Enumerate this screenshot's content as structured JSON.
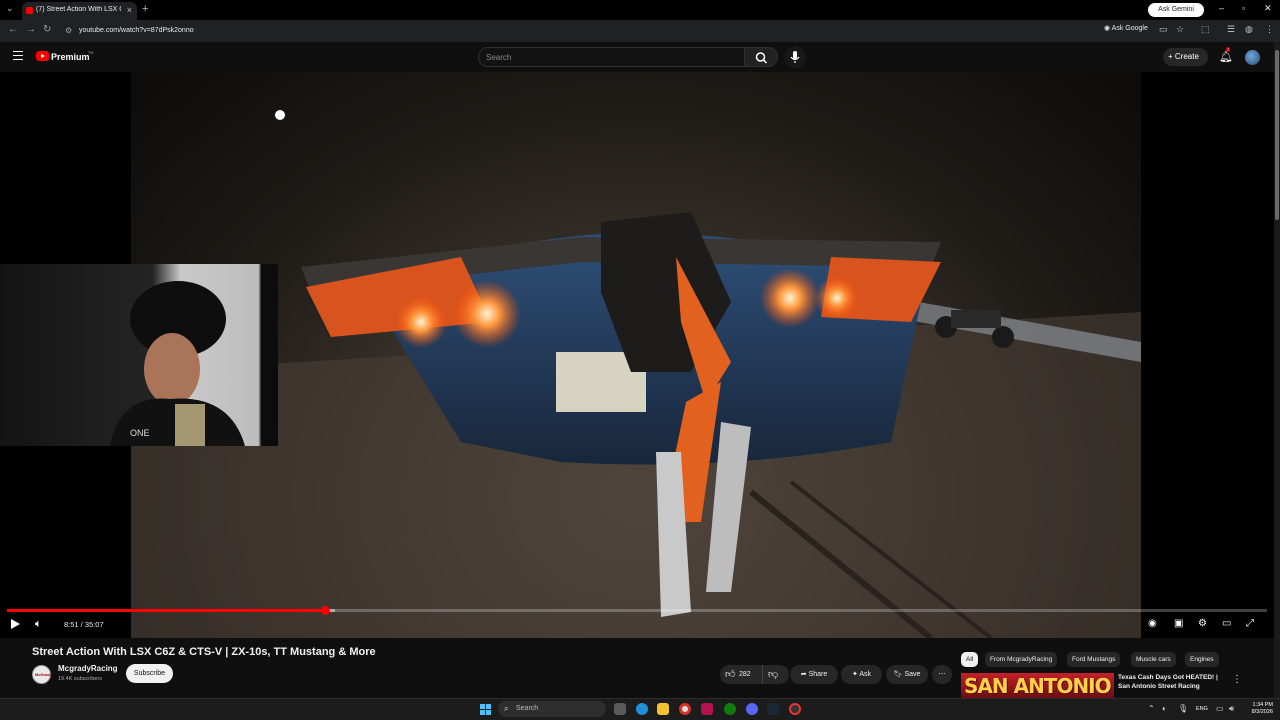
{
  "browser": {
    "tab_title": "(7) Street Action With LSX C6Z",
    "url": "youtube.com/watch?v=87dPsk2onno",
    "ask_gemini": "Ask Gemini",
    "ask_google": "Ask Google"
  },
  "header": {
    "brand": "Premium",
    "region": "TH",
    "search_placeholder": "Search",
    "create_label": "Create",
    "notifications": "7"
  },
  "player": {
    "current_time": "8:51",
    "duration": "35:07",
    "time_display": "8:51 / 35:07",
    "progress_fraction": 0.252,
    "buffer_fraction": 0.26
  },
  "video": {
    "title": "Street Action With LSX C6Z & CTS-V | ZX-10s, TT Mustang & More",
    "channel_name": "McgradyRacing",
    "channel_avatar_text": "McGrady",
    "subscribers": "19.4K subscribers",
    "subscribe_label": "Subscribe",
    "likes": "282",
    "share_label": "Share",
    "ask_label": "Ask",
    "save_label": "Save"
  },
  "chips": [
    "All",
    "From McgradyRacing",
    "Ford Mustangs",
    "Muscle cars",
    "Engines"
  ],
  "recommended": {
    "thumb_text": "SAN ANTONIO",
    "title": "Texas Cash Days Got HEATED! | San Antonio Street Racing"
  },
  "taskbar": {
    "search_label": "Search",
    "language": "ENG",
    "time": "1:34 PM",
    "date": "8/3/2026"
  },
  "colors": {
    "accent": "#ff0000",
    "background": "#0f0f0f",
    "chip_active": "#f1f1f1"
  }
}
